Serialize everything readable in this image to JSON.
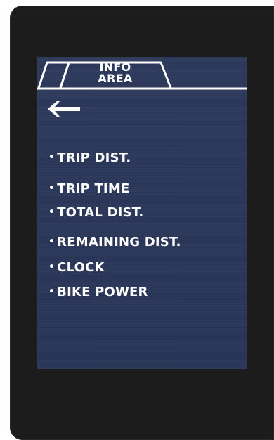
{
  "header": {
    "tab_title": "INFO\nAREA"
  },
  "menu": {
    "bullet": "•",
    "items": [
      {
        "label": "TRIP DIST."
      },
      {
        "label": "TRIP TIME"
      },
      {
        "label": "TOTAL DIST."
      },
      {
        "label": "REMAINING DIST."
      },
      {
        "label": "CLOCK"
      },
      {
        "label": "BIKE POWER"
      }
    ]
  },
  "colors": {
    "screen_bg": "#2c3859",
    "bezel": "#1c1c1c",
    "text": "#ffffff"
  },
  "icons": {
    "back": "arrow-left-icon"
  }
}
